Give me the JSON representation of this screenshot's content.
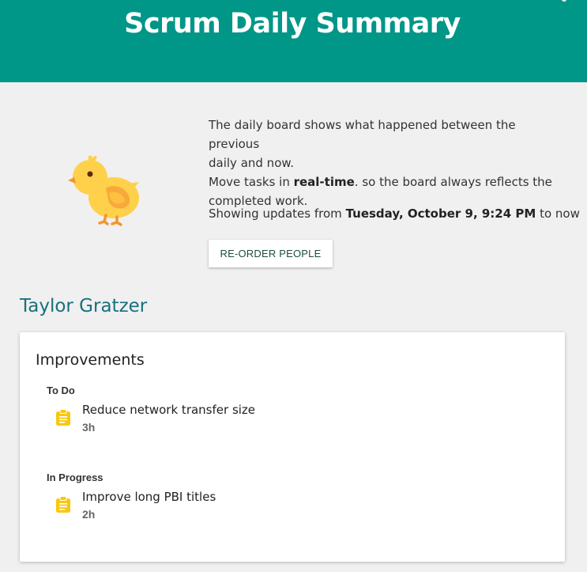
{
  "header": {
    "title": "Scrum Daily Summary"
  },
  "intro": {
    "line1": "The daily board shows what happened between the previous",
    "line2": "daily and now.",
    "line3_prefix": "Move tasks in ",
    "line3_bold": "real-time",
    "line3_suffix": ". so the board always reflects the",
    "line4": "completed work."
  },
  "since": {
    "prefix": "Showing updates from ",
    "date": "Tuesday, October 9, 9:24 PM",
    "suffix": " to now"
  },
  "toolbar": {
    "reorder_label": "RE-ORDER PEOPLE"
  },
  "person": {
    "name": "Taylor Gratzer",
    "board": {
      "title": "Improvements",
      "columns": [
        {
          "title": "To Do",
          "tasks": [
            {
              "title": "Reduce network transfer size",
              "estimate": "3h"
            }
          ]
        },
        {
          "title": "In Progress",
          "tasks": [
            {
              "title": "Improve long PBI titles",
              "estimate": "2h"
            }
          ]
        }
      ]
    }
  },
  "icons": {
    "mascot": "chick-icon",
    "task": "clipboard-icon"
  },
  "colors": {
    "header_bg": "#009688",
    "person_name": "#17707e",
    "button_text": "#1e4d3f",
    "task_icon": "#f9c80e"
  }
}
